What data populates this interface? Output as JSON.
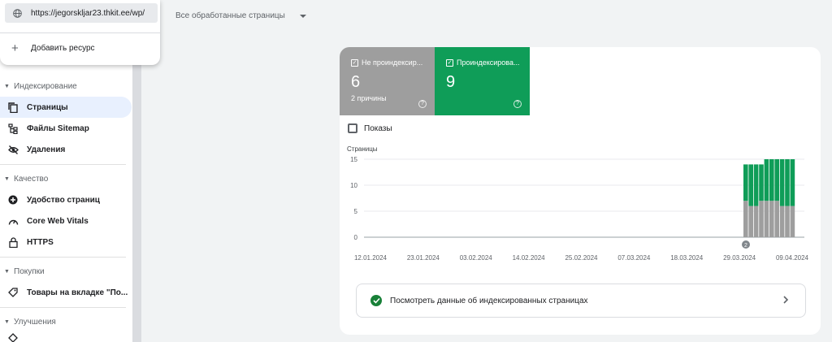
{
  "popup": {
    "property_url": "https://jegorskljar23.thkit.ee/wp/",
    "add_resource": "Добавить ресурс"
  },
  "filter": {
    "label": "Все обработанные страницы"
  },
  "sidebar": {
    "sections": [
      {
        "title": "Индексирование",
        "items": [
          "Страницы",
          "Файлы Sitemap",
          "Удаления"
        ]
      },
      {
        "title": "Качество",
        "items": [
          "Удобство страниц",
          "Core Web Vitals",
          "HTTPS"
        ]
      },
      {
        "title": "Покупки",
        "items": [
          "Товары на вкладке \"По..."
        ]
      },
      {
        "title": "Улучшения",
        "items": []
      }
    ],
    "active_item": "Страницы"
  },
  "tiles": [
    {
      "label": "Не проиндексир...",
      "value": "6",
      "sub": "2 причины",
      "color": "#9e9e9e"
    },
    {
      "label": "Проиндексирова...",
      "value": "9",
      "sub": "",
      "color": "#0f9d58"
    }
  ],
  "show_impressions": "Показы",
  "link_card": {
    "label": "Посмотреть данные об индексированных страницах"
  },
  "chart_data": {
    "type": "bar",
    "stacked": true,
    "ylabel": "Страницы",
    "ylim": [
      0,
      15
    ],
    "yticks": [
      0,
      5,
      10,
      15
    ],
    "xticks": [
      "12.01.2024",
      "23.01.2024",
      "03.02.2024",
      "14.02.2024",
      "25.02.2024",
      "07.03.2024",
      "18.03.2024",
      "29.03.2024",
      "09.04.2024"
    ],
    "annotation": "2",
    "categories": [
      "27.03.2024",
      "28.03.2024",
      "29.03.2024",
      "30.03.2024",
      "31.03.2024",
      "01.04.2024",
      "02.04.2024",
      "03.04.2024",
      "04.04.2024",
      "05.04.2024"
    ],
    "series": [
      {
        "color": "#9e9e9e",
        "values": [
          7,
          6,
          6,
          7,
          7,
          7,
          7,
          6,
          6,
          6
        ]
      },
      {
        "color": "#0f9d58",
        "values": [
          7,
          8,
          8,
          7,
          8,
          8,
          8,
          9,
          9,
          9
        ]
      }
    ],
    "grid": true
  }
}
